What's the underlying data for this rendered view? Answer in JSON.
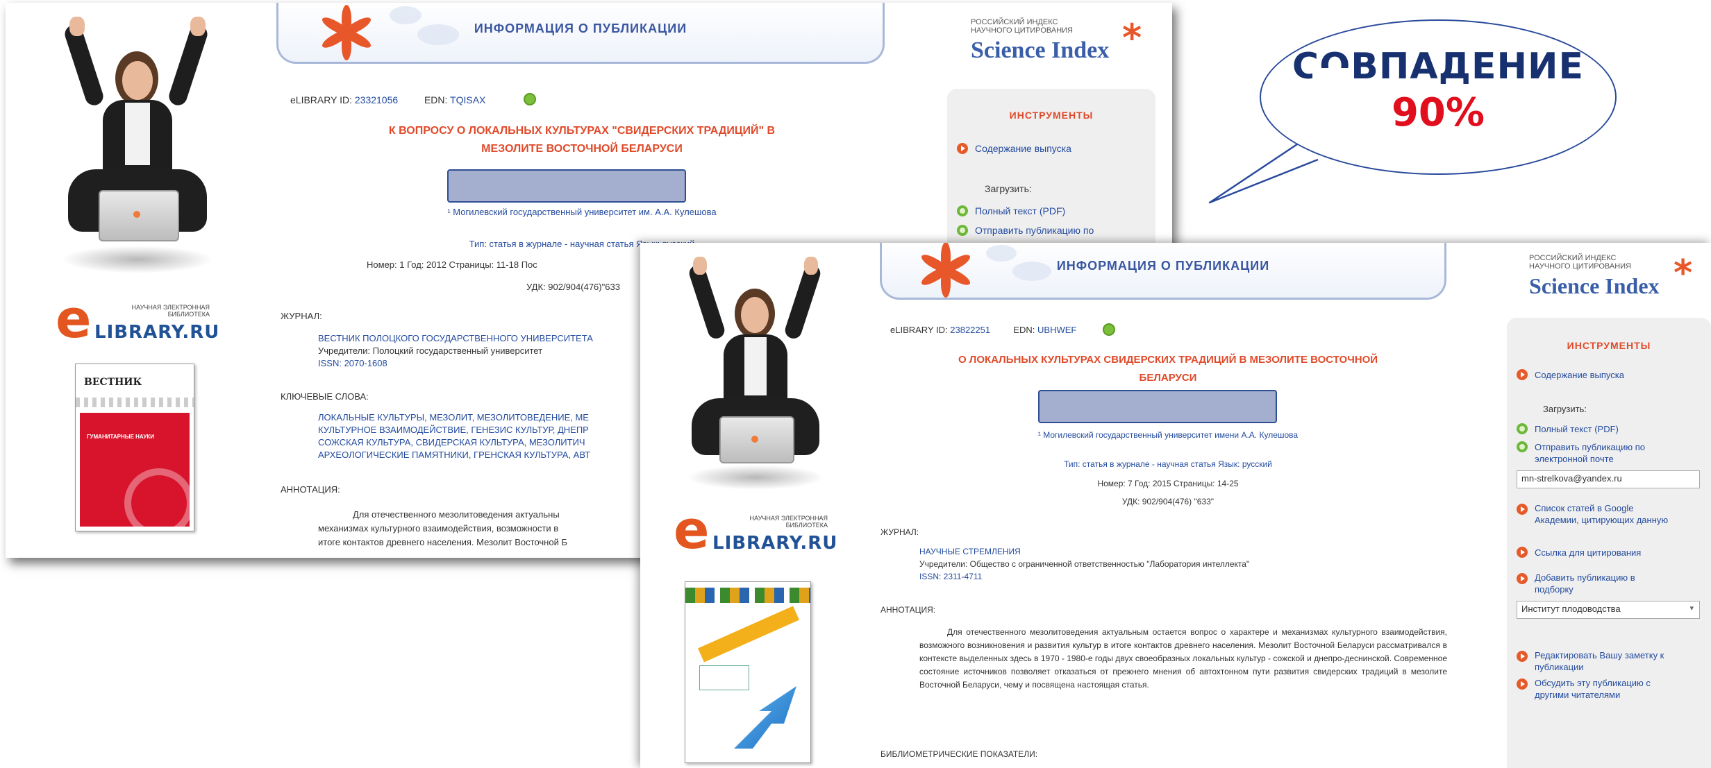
{
  "bubble": {
    "line1": "СОВПАДЕНИЕ",
    "line2": "90%"
  },
  "shot1": {
    "banner_title": "ИНФОРМАЦИЯ О ПУБЛИКАЦИИ",
    "elibrary_id_label": "eLIBRARY ID:",
    "elibrary_id": "23321056",
    "edn_label": "EDN:",
    "edn": "TQISAX",
    "title_line1": "К ВОПРОСУ О ЛОКАЛЬНЫХ КУЛЬТУРАХ \"СВИДЕРСКИХ ТРАДИЦИЙ\" В",
    "title_line2": "МЕЗОЛИТЕ ВОСТОЧНОЙ БЕЛАРУСИ",
    "affiliation": "¹ Могилевский государственный университет им. А.А. Кулешова",
    "type_line": "Тип: статья в журнале - научная статья       Язык: русский",
    "number_line": "Номер: 1      Год: 2012      Страницы: 11-18      Пос",
    "udk": "УДК: 902/904(476)\"633",
    "journal_label": "ЖУРНАЛ:",
    "journal_name": "ВЕСТНИК ПОЛОЦКОГО ГОСУДАРСТВЕННОГО УНИВЕРСИТЕТА",
    "founder": "Учредители: Полоцкий государственный университет",
    "issn": "ISSN: 2070-1608",
    "keywords_label": "КЛЮЧЕВЫЕ СЛОВА:",
    "keywords_line1": "ЛОКАЛЬНЫЕ КУЛЬТУРЫ, МЕЗОЛИТ, МЕЗОЛИТОВЕДЕНИЕ, МЕ",
    "keywords_line2": "КУЛЬТУРНОЕ ВЗАИМОДЕЙСТВИЕ, ГЕНЕЗИС КУЛЬТУР, ДНЕПР",
    "keywords_line3": "СОЖСКАЯ КУЛЬТУРА, СВИДЕРСКАЯ КУЛЬТУРА, МЕЗОЛИТИЧ",
    "keywords_line4": "АРХЕОЛОГИЧЕСКИЕ ПАМЯТНИКИ, ГРЕНСКАЯ КУЛЬТУРА, АВТ",
    "abstract_label": "АННОТАЦИЯ:",
    "abstract_line1": "Для отечественного мезолитоведения актуальны",
    "abstract_line2": "механизмах культурного взаимодействия, возможности в",
    "abstract_line3": "итоге контактов древнего населения. Мезолит Восточной Б",
    "si_line1": "РОССИЙСКИЙ ИНДЕКС",
    "si_line2": "НАУЧНОГО ЦИТИРОВАНИЯ",
    "si_name": "Science Index",
    "tools_title": "ИНСТРУМЕНТЫ",
    "tools_contents": "Содержание выпуска",
    "tools_download": "Загрузить:",
    "tools_fulltext": "Полный текст (PDF)",
    "tools_email": "Отправить публикацию по",
    "elib_top": "НАУЧНАЯ ЭЛЕКТРОННАЯ",
    "elib_mid": "БИБЛИОТЕКА",
    "elib_word": "LIBRARY.RU",
    "cover_title": "ВЕСТНИК",
    "cover_text": "ГУМАНИТАРНЫЕ НАУКИ"
  },
  "shot2": {
    "banner_title": "ИНФОРМАЦИЯ О ПУБЛИКАЦИИ",
    "elibrary_id_label": "eLIBRARY ID:",
    "elibrary_id": "23822251",
    "edn_label": "EDN:",
    "edn": "UBHWEF",
    "title_line1": "О ЛОКАЛЬНЫХ КУЛЬТУРАХ СВИДЕРСКИХ ТРАДИЦИЙ В МЕЗОЛИТЕ ВОСТОЧНОЙ",
    "title_line2": "БЕЛАРУСИ",
    "affiliation": "¹ Могилевский государственный университет имени А.А. Кулешова",
    "type_line": "Тип: статья в журнале - научная статья      Язык: русский",
    "number_line": "Номер: 7      Год: 2015      Страницы: 14-25",
    "udk": "УДК: 902/904(476) \"633\"",
    "journal_label": "ЖУРНАЛ:",
    "journal_name": "НАУЧНЫЕ СТРЕМЛЕНИЯ",
    "founder": "Учредители: Общество с ограниченной ответственностью \"Лаборатория интеллекта\"",
    "issn": "ISSN: 2311-4711",
    "abstract_label": "АННОТАЦИЯ:",
    "abstract": "Для отечественного мезолитоведения актуальным остается вопрос о характере и механизмах культурного взаимодействия, возможного возникновения и развития культур в итоге контактов древнего населения. Мезолит Восточной Беларуси рассматривался в контексте выделенных здесь в 1970 - 1980-е годы двух своеобразных локальных культур - сожской и днепро-деснинской. Современное состояние источников позволяет отказаться от прежнего мнения об автохтонном пути развития свидерских традиций в мезолите Восточной Беларуси, чему и посвящена настоящая статья.",
    "biblio_label": "БИБЛИОМЕТРИЧЕСКИЕ ПОКАЗАТЕЛИ:",
    "si_line1": "РОССИЙСКИЙ ИНДЕКС",
    "si_line2": "НАУЧНОГО ЦИТИРОВАНИЯ",
    "si_name": "Science Index",
    "tools_title": "ИНСТРУМЕНТЫ",
    "tools_contents": "Содержание выпуска",
    "tools_download": "Загрузить:",
    "tools_fulltext": "Полный текст (PDF)",
    "tools_email": "Отправить публикацию по электронной почте",
    "tools_email_value": "mn-strelkova@yandex.ru",
    "tools_google": "Список статей в Google Академии, цитирующих данную",
    "tools_cite": "Ссылка для цитирования",
    "tools_add": "Добавить публикацию в подборку",
    "tools_select": "Институт плодоводства",
    "tools_note": "Редактировать Вашу заметку к публикации",
    "tools_discuss": "Обсудить эту публикацию с другими читателями",
    "elib_top": "НАУЧНАЯ ЭЛЕКТРОННАЯ",
    "elib_mid": "БИБЛИОТЕКА",
    "elib_word": "LIBRARY.RU"
  },
  "colors": {
    "title_red": "#e04a2a",
    "link_blue": "#234b9e",
    "bubble_navy": "#17306f",
    "bubble_red": "#e10f1e",
    "redaction": "#a4afd0"
  }
}
